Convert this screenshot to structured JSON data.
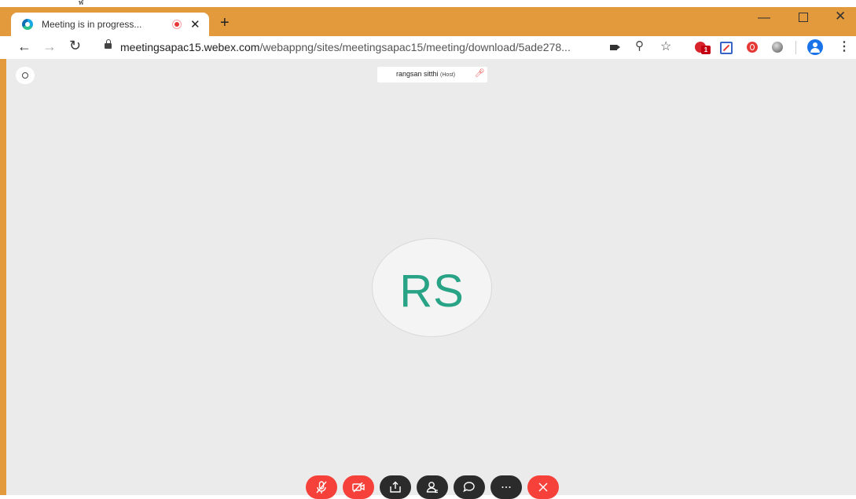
{
  "top_mark": "ฬ",
  "browser": {
    "tab_title": "Meeting is in progress...",
    "new_tab": "+",
    "url_domain": "meetingsapac15.webex.com",
    "url_path": "/webappng/sites/meetingsapac15/meeting/download/5ade278...",
    "ext_badge": "1",
    "colors": {
      "frame": "#e29a3c"
    }
  },
  "meeting": {
    "participant_name": "rangsan sitthi",
    "participant_role": "(Host)",
    "avatar_initials": "RS",
    "colors": {
      "initials": "#28a386",
      "end_call": "#f5413a"
    }
  }
}
